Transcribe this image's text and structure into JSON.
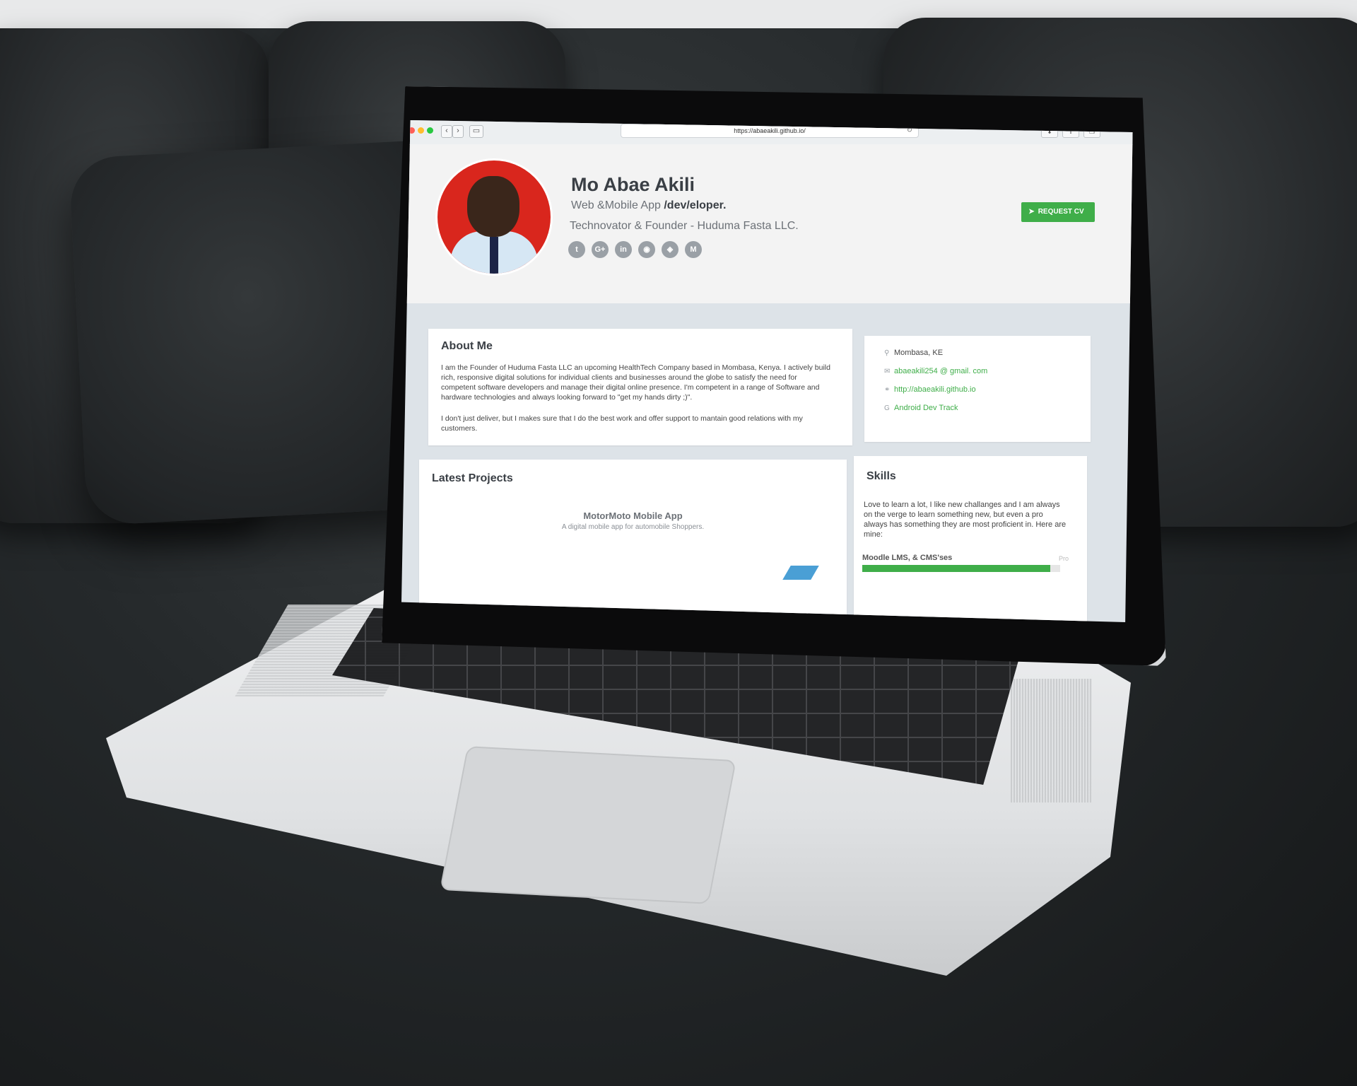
{
  "browser": {
    "url": "https://abaeakili.github.io/"
  },
  "profile": {
    "name": "Mo Abae Akili",
    "role_prefix": "Web &Mobile App ",
    "role_bold": "/dev/eloper.",
    "company_line": "Technovator & Founder - Huduma Fasta LLC.",
    "request_cv_label": "REQUEST CV",
    "socials": [
      {
        "icon": "twitter-icon",
        "glyph": "t"
      },
      {
        "icon": "google-plus-icon",
        "glyph": "G+"
      },
      {
        "icon": "linkedin-icon",
        "glyph": "in"
      },
      {
        "icon": "github-icon",
        "glyph": "◉"
      },
      {
        "icon": "codepen-icon",
        "glyph": "◈"
      },
      {
        "icon": "medium-icon",
        "glyph": "M"
      }
    ]
  },
  "about": {
    "title": "About Me",
    "paragraph1": "I am the Founder of Huduma Fasta LLC an upcoming HealthTech Company based in Mombasa, Kenya. I actively build rich, responsive digital solutions for individual clients and businesses around the globe to satisfy the need for competent software developers and manage their digital online presence. I'm competent in a range of Software and hardware technologies and always looking forward to \"get my hands dirty ;)\".",
    "paragraph2": "I don't just deliver, but I makes sure that I do the best work and offer support to mantain good relations with my customers."
  },
  "contact": {
    "location": "Mombasa, KE",
    "email": "abaeakili254 @ gmail. com",
    "website": "http://abaeakili.github.io",
    "track": "Android Dev Track"
  },
  "projects": {
    "title": "Latest Projects",
    "items": [
      {
        "name": "MotorMoto Mobile App",
        "description": "A digital mobile app for automobile Shoppers."
      }
    ]
  },
  "skills": {
    "title": "Skills",
    "intro": "Love to learn a lot, I like new challanges and I am always on the verge to learn something new, but even a pro always has something they are most proficient in. Here are mine:",
    "items": [
      {
        "name": "Moodle LMS, & CMS'ses",
        "level": "Pro",
        "progress": 0.95
      }
    ]
  },
  "colors": {
    "accent": "#3fae49",
    "avatar_bg": "#d9261d"
  }
}
